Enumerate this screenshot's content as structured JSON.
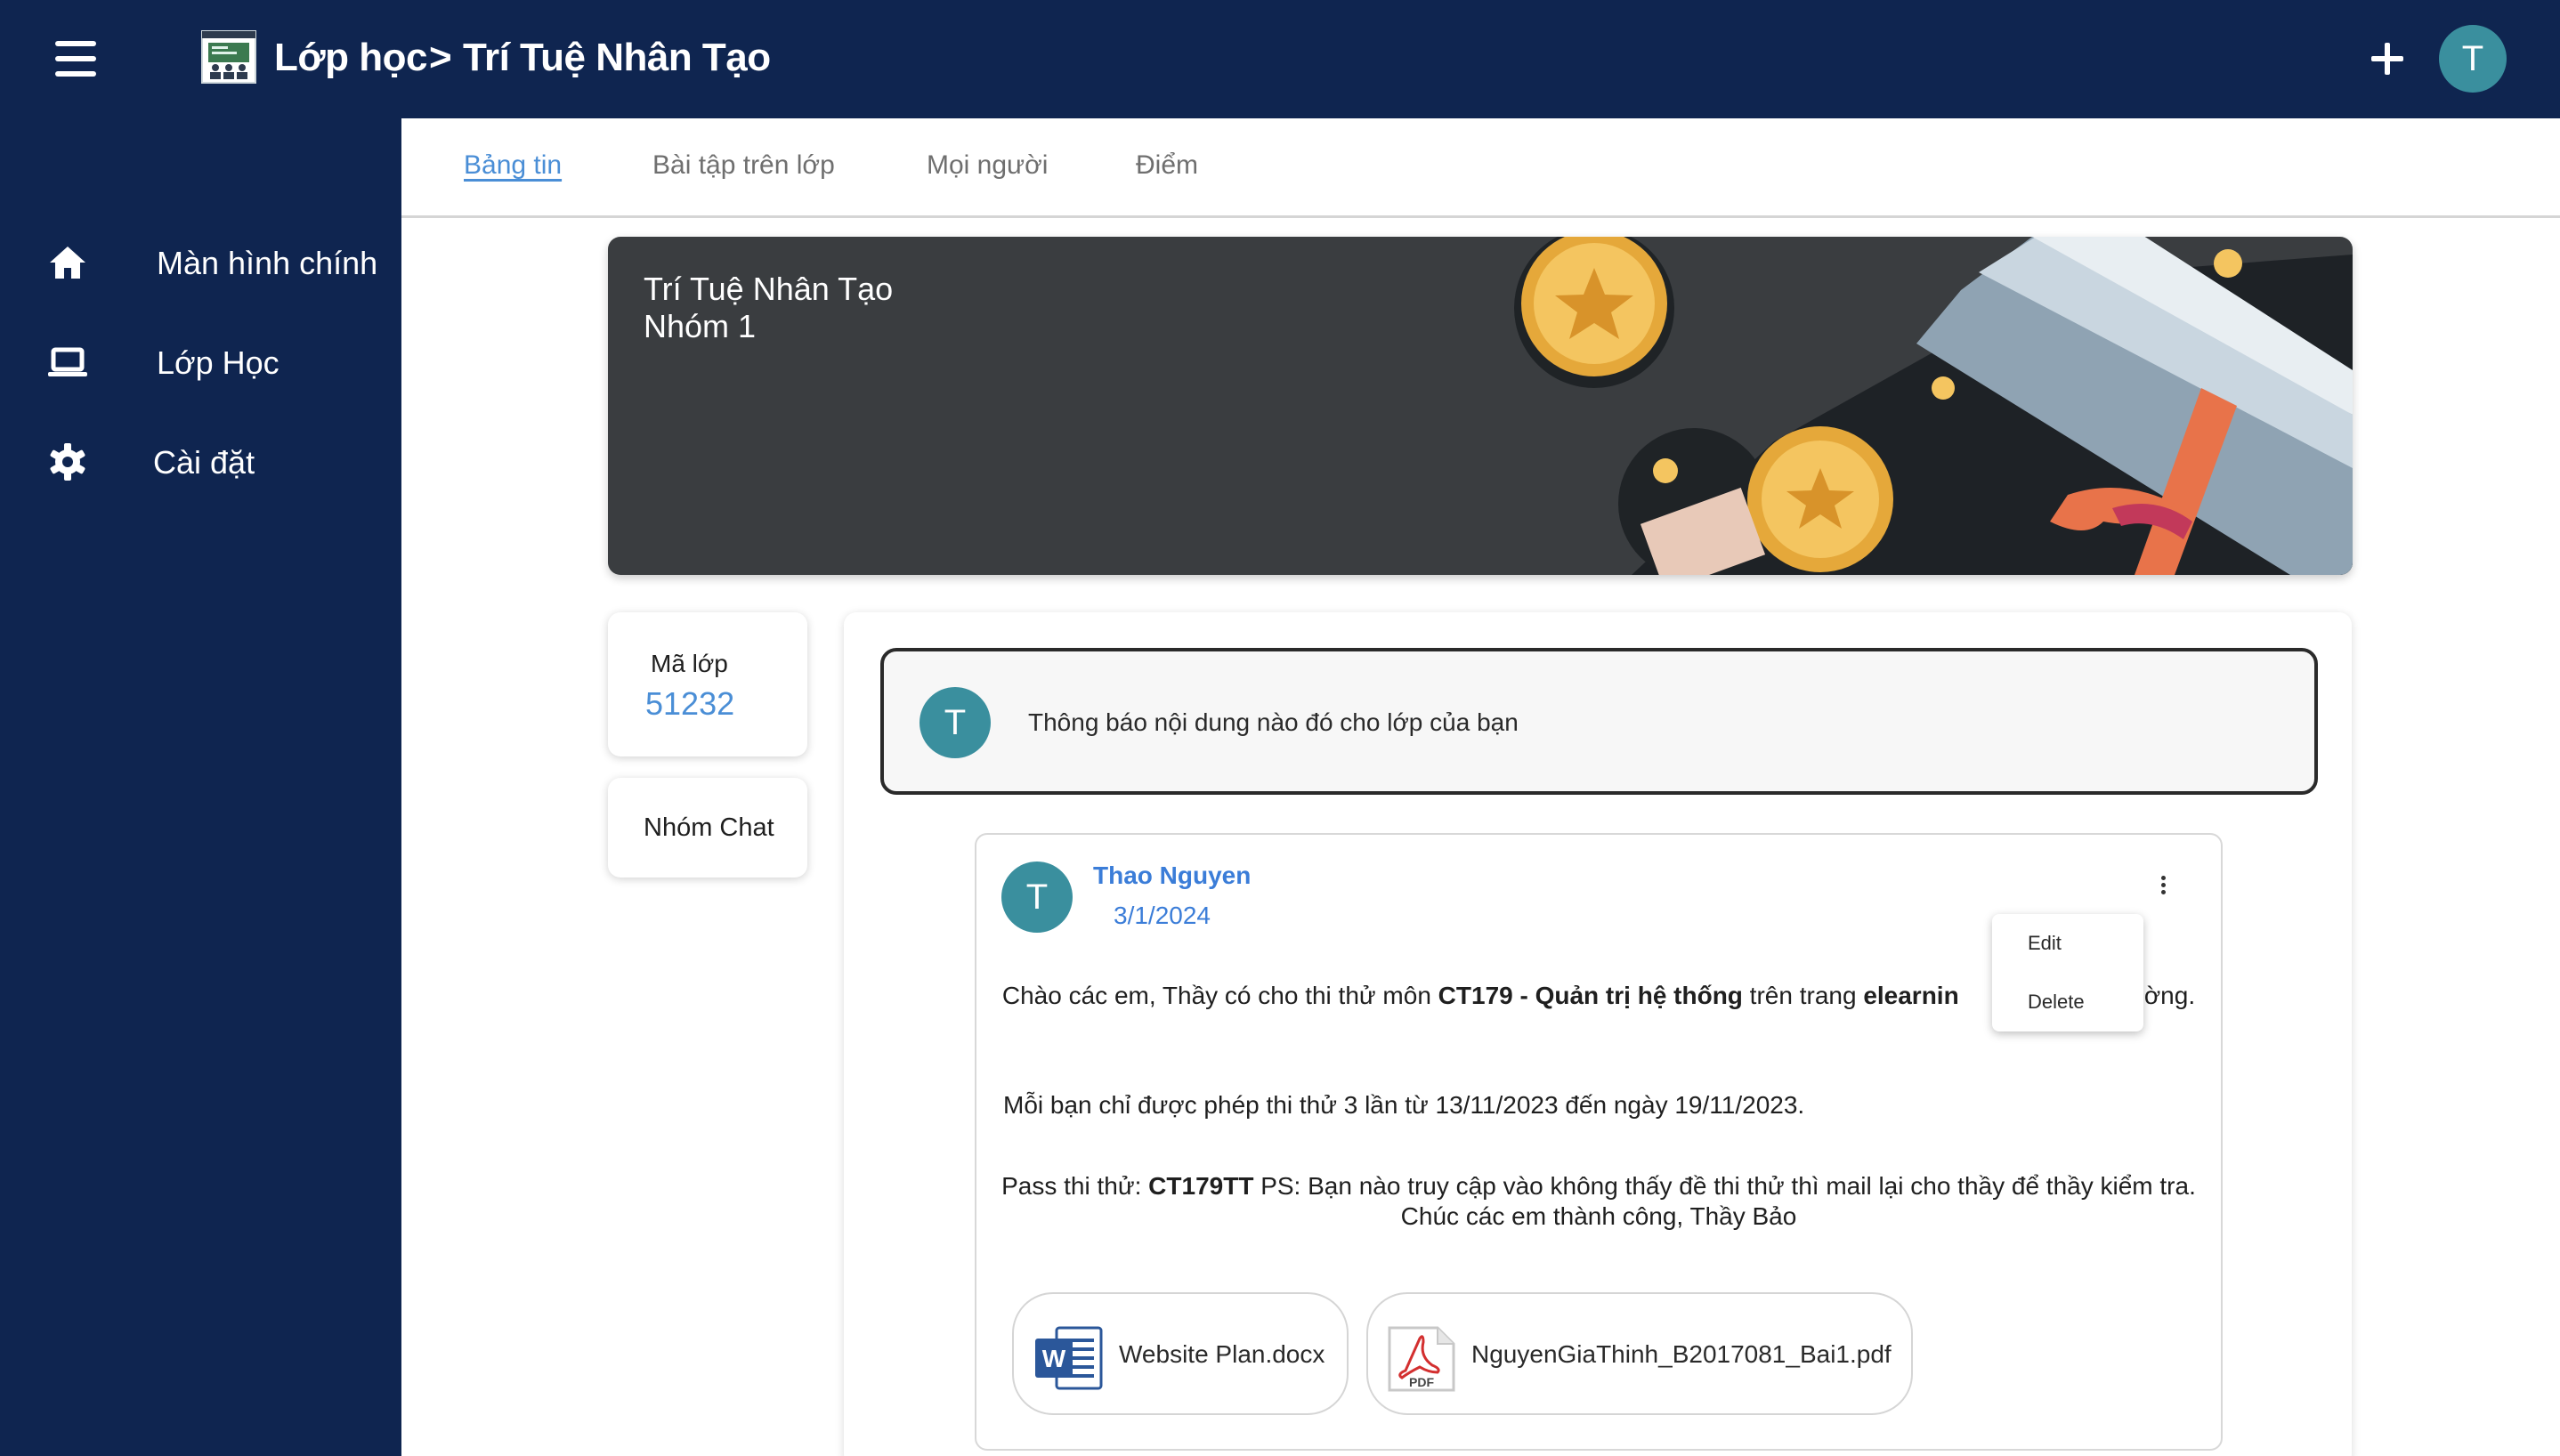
{
  "header": {
    "breadcrumb_home": "Lớp học",
    "breadcrumb_separator": ">",
    "breadcrumb_current": "Trí Tuệ Nhân Tạo",
    "avatar_initial": "T",
    "icons": {
      "menu": "hamburger-icon",
      "logo": "classroom-logo-icon",
      "add": "plus-icon"
    }
  },
  "sidebar": {
    "items": [
      {
        "label": "Màn hình chính",
        "icon": "home-icon"
      },
      {
        "label": "Lớp Học",
        "icon": "laptop-icon"
      },
      {
        "label": "Cài đặt",
        "icon": "gear-icon"
      }
    ]
  },
  "tabs": [
    {
      "label": "Bảng tin",
      "active": true
    },
    {
      "label": "Bài tập trên lớp",
      "active": false
    },
    {
      "label": "Mọi người",
      "active": false
    },
    {
      "label": "Điểm",
      "active": false
    }
  ],
  "banner": {
    "title": "Trí Tuệ Nhân Tạo",
    "subtitle": "Nhóm 1",
    "background_color": "#3a3d40"
  },
  "class_code": {
    "label": "Mã lớp",
    "value": "51232"
  },
  "group_chat": {
    "label": "Nhóm Chat"
  },
  "announce": {
    "avatar_initial": "T",
    "placeholder": "Thông báo nội dung nào đó cho lớp của bạn"
  },
  "post": {
    "avatar_initial": "T",
    "author": "Thao Nguyen",
    "date": "3/1/2024",
    "body1": {
      "t1": "Chào các em, Thầy có cho thi thử môn ",
      "b1": "CT179 - Quản trị hệ thống",
      "t2": " trên trang ",
      "b2": "elearnin",
      "t3": "",
      "t4": "ı của Trường."
    },
    "body2": "Mỗi bạn chỉ được phép thi thử 3 lần từ 13/11/2023 đến ngày 19/11/2023.",
    "body3": {
      "t1": "Pass thi thử: ",
      "b1": "CT179TT",
      "t2": " PS: Bạn nào truy cập vào không thấy đề thi thử thì mail lại cho thầy để thầy kiểm tra. Chúc các em thành công, Thầy Bảo"
    },
    "attachments": [
      {
        "name": "Website Plan.docx",
        "icon": "word-file-icon"
      },
      {
        "name": "NguyenGiaThinh_B2017081_Bai1.pdf",
        "icon": "pdf-file-icon"
      }
    ]
  },
  "context_menu": {
    "edit": "Edit",
    "delete": "Delete"
  },
  "colors": {
    "nav_background": "#0f2550",
    "accent": "#4a8ed6",
    "avatar": "#3a8f9e",
    "link": "#3b7dd8"
  }
}
